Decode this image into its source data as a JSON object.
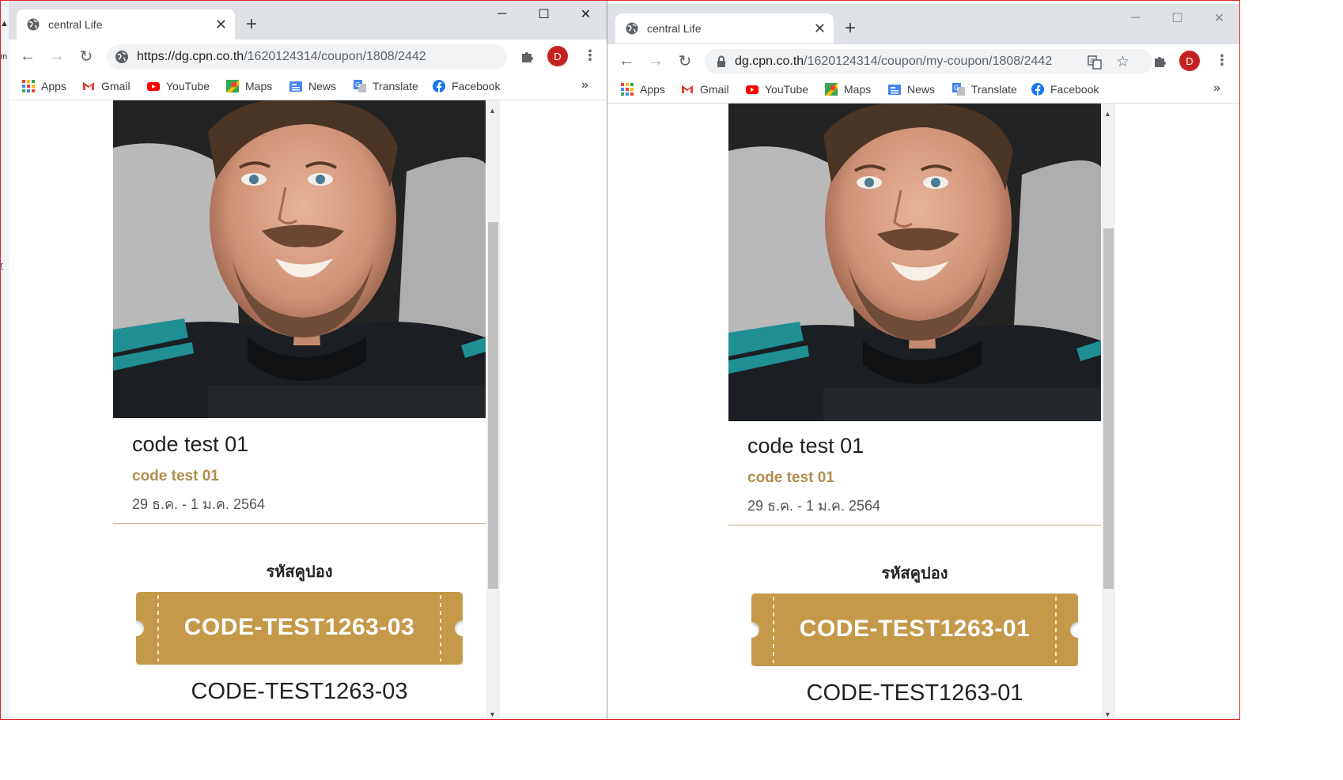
{
  "windows": [
    {
      "tab_title": "central Life",
      "url_host": "https://dg.cpn.co.th",
      "url_path": "/1620124314/coupon/1808/2442",
      "avatar_letter": "D",
      "bookmarks": [
        "Apps",
        "Gmail",
        "YouTube",
        "Maps",
        "News",
        "Translate",
        "Facebook"
      ],
      "bookmarks_more": "»",
      "card": {
        "title": "code test 01",
        "subtitle": "code test 01",
        "date_range": "29 ธ.ค. - 1 ม.ค. 2564",
        "coupon_heading": "รหัสคูปอง",
        "coupon_code": "CODE-TEST1263-03",
        "coupon_code_plain": "CODE-TEST1263-03"
      }
    },
    {
      "tab_title": "central Life",
      "url_host": "dg.cpn.co.th",
      "url_path": "/1620124314/coupon/my-coupon/1808/2442",
      "avatar_letter": "D",
      "bookmarks": [
        "Apps",
        "Gmail",
        "YouTube",
        "Maps",
        "News",
        "Translate",
        "Facebook"
      ],
      "bookmarks_more": "»",
      "card": {
        "title": "code test 01",
        "subtitle": "code test 01",
        "date_range": "29 ธ.ค. - 1 ม.ค. 2564",
        "coupon_heading": "รหัสคูปอง",
        "coupon_code": "CODE-TEST1263-01",
        "coupon_code_plain": "CODE-TEST1263-01"
      }
    }
  ],
  "colors": {
    "ticket": "#c4994a",
    "subtitle": "#b08d4c",
    "avatar": "#c5221f",
    "tabstrip": "#dee1e6"
  },
  "icons": {
    "tab_favicon": "globe-icon",
    "new_tab": "plus-icon",
    "back": "arrow-left-icon",
    "forward": "arrow-right-icon",
    "reload": "reload-icon",
    "extensions": "puzzle-icon",
    "menu": "kebab-icon",
    "bookmark_star": "star-icon",
    "translate_page": "translate-icon",
    "site_info_w1": "info-icon",
    "site_info_w2": "lock-icon"
  }
}
